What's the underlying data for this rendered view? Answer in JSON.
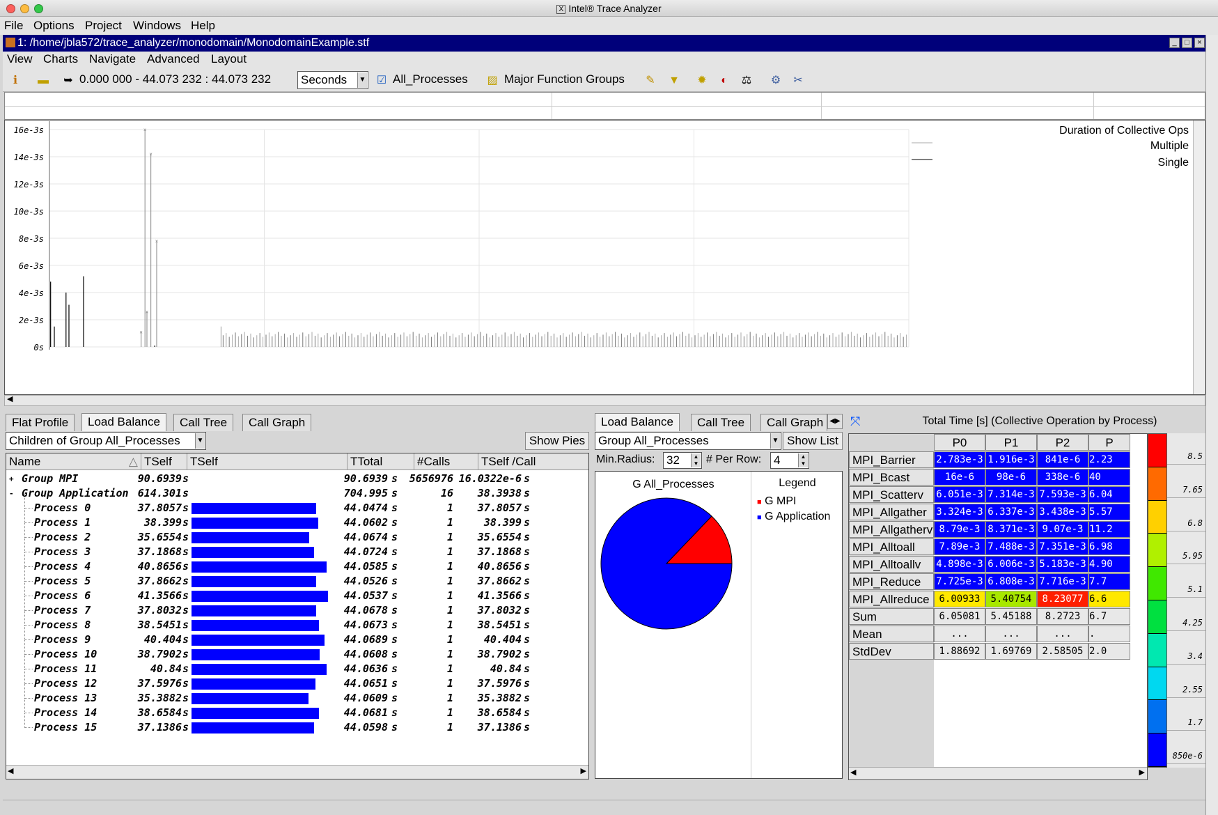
{
  "window_title": "Intel® Trace Analyzer",
  "menubar": [
    "File",
    "Options",
    "Project",
    "Windows",
    "Help"
  ],
  "document": {
    "path": "1: /home/jbla572/trace_analyzer/monodomain/MonodomainExample.stf"
  },
  "submenu": [
    "View",
    "Charts",
    "Navigate",
    "Advanced",
    "Layout"
  ],
  "toolbar": {
    "time_range": "0.000 000 - 44.073 232 : 44.073 232",
    "unit": "Seconds",
    "process_group": "All_Processes",
    "function_group": "Major Function Groups"
  },
  "chart_data": {
    "type": "scatter",
    "title": "Duration of Collective Ops",
    "legend": [
      "Multiple",
      "Single"
    ],
    "legend_placement": "top-right",
    "ylabel": "",
    "ylim": [
      0,
      0.016
    ],
    "yticks": [
      "0s",
      "2e-3s",
      "4e-3s",
      "6e-3s",
      "8e-3s",
      "10e-3s",
      "12e-3s",
      "14e-3s",
      "16e-3s"
    ],
    "grid": true,
    "xlim": [
      0,
      44.073232
    ],
    "multiple_spikes": [
      {
        "x": 4.9,
        "y": 0.016
      },
      {
        "x": 5.2,
        "y": 0.0142
      },
      {
        "x": 5.5,
        "y": 0.0078
      },
      {
        "x": 5.0,
        "y": 0.0026
      },
      {
        "x": 4.7,
        "y": 0.0011
      }
    ],
    "single_spikes": [
      {
        "x": 0.06,
        "y": 0.0048
      },
      {
        "x": 0.25,
        "y": 0.0015
      },
      {
        "x": 0.85,
        "y": 0.004
      },
      {
        "x": 1.0,
        "y": 0.0031
      },
      {
        "x": 1.75,
        "y": 0.0052
      },
      {
        "x": 5.4,
        "y": 0.0001
      }
    ],
    "baseline": {
      "x_start": 8.8,
      "x_end": 44.07,
      "y_min": 0.0007,
      "y_max": 0.0011,
      "first_y": 0.0015
    }
  },
  "flat": {
    "tabs": [
      "Flat Profile",
      "Load Balance",
      "Call Tree",
      "Call Graph"
    ],
    "active_tab": 1,
    "combo": "Children of Group All_Processes",
    "show_pies": "Show Pies",
    "columns": [
      "Name",
      "TSelf",
      "TSelf",
      "TTotal",
      "#Calls",
      "TSelf /Call"
    ],
    "groups": [
      {
        "expander": "+",
        "name": "Group MPI",
        "tself": "90.6939",
        "unit": "s",
        "ttotal": "90.6939",
        "calls": "5656976",
        "per": "16.0322e-6"
      },
      {
        "expander": "-",
        "name": "Group Application",
        "tself": "614.301",
        "unit": "s",
        "ttotal": "704.995",
        "calls": "16",
        "per": "38.3938"
      }
    ],
    "processes": [
      {
        "name": "Process 0",
        "tself": "37.8057",
        "ttotal": "44.0474",
        "calls": "1",
        "per": "37.8057",
        "v": 37.8057
      },
      {
        "name": "Process 1",
        "tself": "38.399",
        "ttotal": "44.0602",
        "calls": "1",
        "per": "38.399",
        "v": 38.399
      },
      {
        "name": "Process 2",
        "tself": "35.6554",
        "ttotal": "44.0674",
        "calls": "1",
        "per": "35.6554",
        "v": 35.6554
      },
      {
        "name": "Process 3",
        "tself": "37.1868",
        "ttotal": "44.0724",
        "calls": "1",
        "per": "37.1868",
        "v": 37.1868
      },
      {
        "name": "Process 4",
        "tself": "40.8656",
        "ttotal": "44.0585",
        "calls": "1",
        "per": "40.8656",
        "v": 40.8656
      },
      {
        "name": "Process 5",
        "tself": "37.8662",
        "ttotal": "44.0526",
        "calls": "1",
        "per": "37.8662",
        "v": 37.8662
      },
      {
        "name": "Process 6",
        "tself": "41.3566",
        "ttotal": "44.0537",
        "calls": "1",
        "per": "41.3566",
        "v": 41.3566
      },
      {
        "name": "Process 7",
        "tself": "37.8032",
        "ttotal": "44.0678",
        "calls": "1",
        "per": "37.8032",
        "v": 37.8032
      },
      {
        "name": "Process 8",
        "tself": "38.5451",
        "ttotal": "44.0673",
        "calls": "1",
        "per": "38.5451",
        "v": 38.5451
      },
      {
        "name": "Process 9",
        "tself": "40.404",
        "ttotal": "44.0689",
        "calls": "1",
        "per": "40.404",
        "v": 40.404
      },
      {
        "name": "Process 10",
        "tself": "38.7902",
        "ttotal": "44.0608",
        "calls": "1",
        "per": "38.7902",
        "v": 38.7902
      },
      {
        "name": "Process 11",
        "tself": "40.84",
        "ttotal": "44.0636",
        "calls": "1",
        "per": "40.84",
        "v": 40.84
      },
      {
        "name": "Process 12",
        "tself": "37.5976",
        "ttotal": "44.0651",
        "calls": "1",
        "per": "37.5976",
        "v": 37.5976
      },
      {
        "name": "Process 13",
        "tself": "35.3882",
        "ttotal": "44.0609",
        "calls": "1",
        "per": "35.3882",
        "v": 35.3882
      },
      {
        "name": "Process 14",
        "tself": "38.6584",
        "ttotal": "44.0681",
        "calls": "1",
        "per": "38.6584",
        "v": 38.6584
      },
      {
        "name": "Process 15",
        "tself": "37.1386",
        "ttotal": "44.0598",
        "calls": "1",
        "per": "37.1386",
        "v": 37.1386
      }
    ],
    "unit": "s",
    "bar_max": 41.3566
  },
  "pie": {
    "tabs": [
      "Load Balance",
      "Call Tree",
      "Call Graph"
    ],
    "combo": "Group All_Processes",
    "show_list": "Show List",
    "min_radius_label": "Min.Radius:",
    "min_radius": "32",
    "per_row_label": "# Per Row:",
    "per_row": "4",
    "title": "G All_Processes",
    "legend_title": "Legend",
    "slices": [
      {
        "label": "G MPI",
        "value": 90.6939,
        "color": "#ff0000"
      },
      {
        "label": "G Application",
        "value": 614.301,
        "color": "#0000ff"
      }
    ]
  },
  "matrix": {
    "title": "Total Time [s] (Collective Operation by Process)",
    "columns": [
      "P0",
      "P1",
      "P2",
      "P"
    ],
    "rows": [
      {
        "name": "MPI_Barrier",
        "cells": [
          "2.783e-3",
          "1.916e-3",
          "841e-6",
          "2.23"
        ],
        "colors": [
          "#0000ff",
          "#0000ff",
          "#0000ff",
          "#0000ff"
        ]
      },
      {
        "name": "MPI_Bcast",
        "cells": [
          "16e-6",
          "98e-6",
          "338e-6",
          "40"
        ],
        "colors": [
          "#0000ff",
          "#0000ff",
          "#0000ff",
          "#0000ff"
        ]
      },
      {
        "name": "MPI_Scatterv",
        "cells": [
          "6.051e-3",
          "7.314e-3",
          "7.593e-3",
          "6.04"
        ],
        "colors": [
          "#0000ff",
          "#0000ff",
          "#0000ff",
          "#0000ff"
        ]
      },
      {
        "name": "MPI_Allgather",
        "cells": [
          "3.324e-3",
          "6.337e-3",
          "3.438e-3",
          "5.57"
        ],
        "colors": [
          "#0000ff",
          "#0000ff",
          "#0000ff",
          "#0000ff"
        ]
      },
      {
        "name": "MPI_Allgatherv",
        "cells": [
          "8.79e-3",
          "8.371e-3",
          "9.07e-3",
          "11.2"
        ],
        "colors": [
          "#0000ff",
          "#0000ff",
          "#0000ff",
          "#0000ff"
        ]
      },
      {
        "name": "MPI_Alltoall",
        "cells": [
          "7.89e-3",
          "7.488e-3",
          "7.351e-3",
          "6.98"
        ],
        "colors": [
          "#0000ff",
          "#0000ff",
          "#0000ff",
          "#0000ff"
        ]
      },
      {
        "name": "MPI_Alltoallv",
        "cells": [
          "4.898e-3",
          "6.006e-3",
          "5.183e-3",
          "4.90"
        ],
        "colors": [
          "#0000ff",
          "#0000ff",
          "#0000ff",
          "#0000ff"
        ]
      },
      {
        "name": "MPI_Reduce",
        "cells": [
          "7.725e-3",
          "6.808e-3",
          "7.716e-3",
          "7.7"
        ],
        "colors": [
          "#0000ff",
          "#0000ff",
          "#0000ff",
          "#0000ff"
        ]
      },
      {
        "name": "MPI_Allreduce",
        "cells": [
          "6.00933",
          "5.40754",
          "8.23077",
          "6.6"
        ],
        "colors": [
          "#ffe800",
          "#a8e800",
          "#ff2000",
          "#ffe800"
        ]
      },
      {
        "name": "Sum",
        "cells": [
          "6.05081",
          "5.45188",
          "8.2723",
          "6.7"
        ],
        "colors": [
          "",
          "",
          "",
          ""
        ]
      },
      {
        "name": "Mean",
        "cells": [
          "...",
          "...",
          "...",
          "."
        ],
        "colors": [
          "",
          "",
          "",
          ""
        ]
      },
      {
        "name": "StdDev",
        "cells": [
          "1.88692",
          "1.69769",
          "2.58505",
          "2.0"
        ],
        "colors": [
          "",
          "",
          "",
          ""
        ]
      }
    ],
    "scale_labels": [
      "8.5",
      "7.65",
      "6.8",
      "5.95",
      "5.1",
      "4.25",
      "3.4",
      "2.55",
      "1.7",
      "850e-6"
    ],
    "scale_colors": [
      "#ff0000",
      "#ff6a00",
      "#ffd000",
      "#b0f000",
      "#40e800",
      "#00e040",
      "#00e8b0",
      "#00d8f0",
      "#0070f0",
      "#0000ff"
    ]
  }
}
